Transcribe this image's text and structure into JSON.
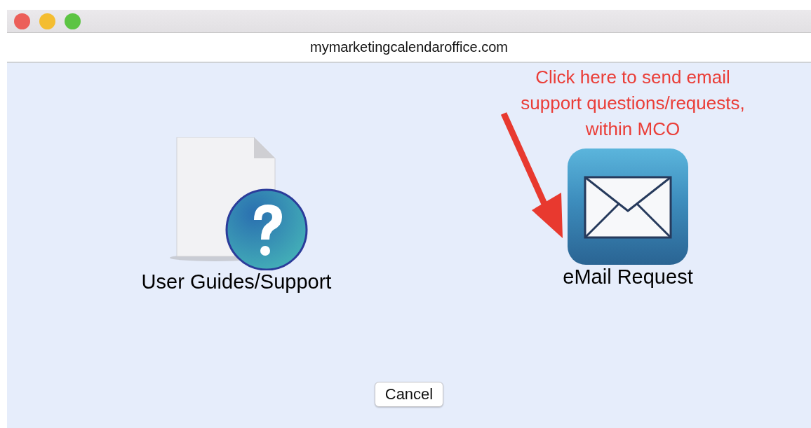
{
  "window": {
    "url": "mymarketingcalendaroffice.com"
  },
  "options": [
    {
      "kind": "guides",
      "label": "User Guides/Support"
    },
    {
      "kind": "email",
      "label": "eMail Request"
    }
  ],
  "annotation": {
    "text": "Click here to send email support questions/requests, within MCO"
  },
  "buttons": [
    "Cancel"
  ]
}
